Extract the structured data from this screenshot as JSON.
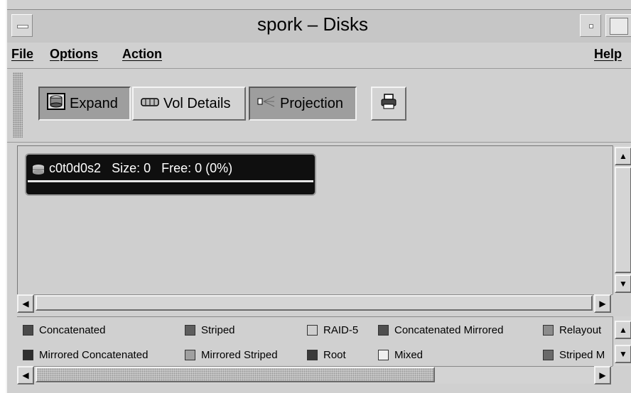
{
  "window": {
    "title": "spork – Disks"
  },
  "menubar": {
    "file": "File",
    "options": "Options",
    "action": "Action",
    "help": "Help"
  },
  "toolbar": {
    "expand": "Expand",
    "vol_details": "Vol Details",
    "projection": "Projection",
    "print_icon": "printer-icon"
  },
  "disk": {
    "name": "c0t0d0s2",
    "size": "Size: 0",
    "free": "Free: 0 (0%)"
  },
  "legend": {
    "items": [
      {
        "label": "Concatenated",
        "color": "#4a4a4a"
      },
      {
        "label": "Striped",
        "color": "#5e5e5e"
      },
      {
        "label": "RAID-5",
        "color": "#cfcfcf"
      },
      {
        "label": "Concatenated Mirrored",
        "color": "#4f4f4f"
      },
      {
        "label": "Relayout",
        "color": "#8c8c8c"
      },
      {
        "label": "Mirrored Concatenated",
        "color": "#2f2f2f"
      },
      {
        "label": "Mirrored Striped",
        "color": "#a0a0a0"
      },
      {
        "label": "Root",
        "color": "#3a3a3a"
      },
      {
        "label": "Mixed",
        "color": "#efefef"
      },
      {
        "label": "Striped M",
        "color": "#6a6a6a"
      }
    ]
  }
}
